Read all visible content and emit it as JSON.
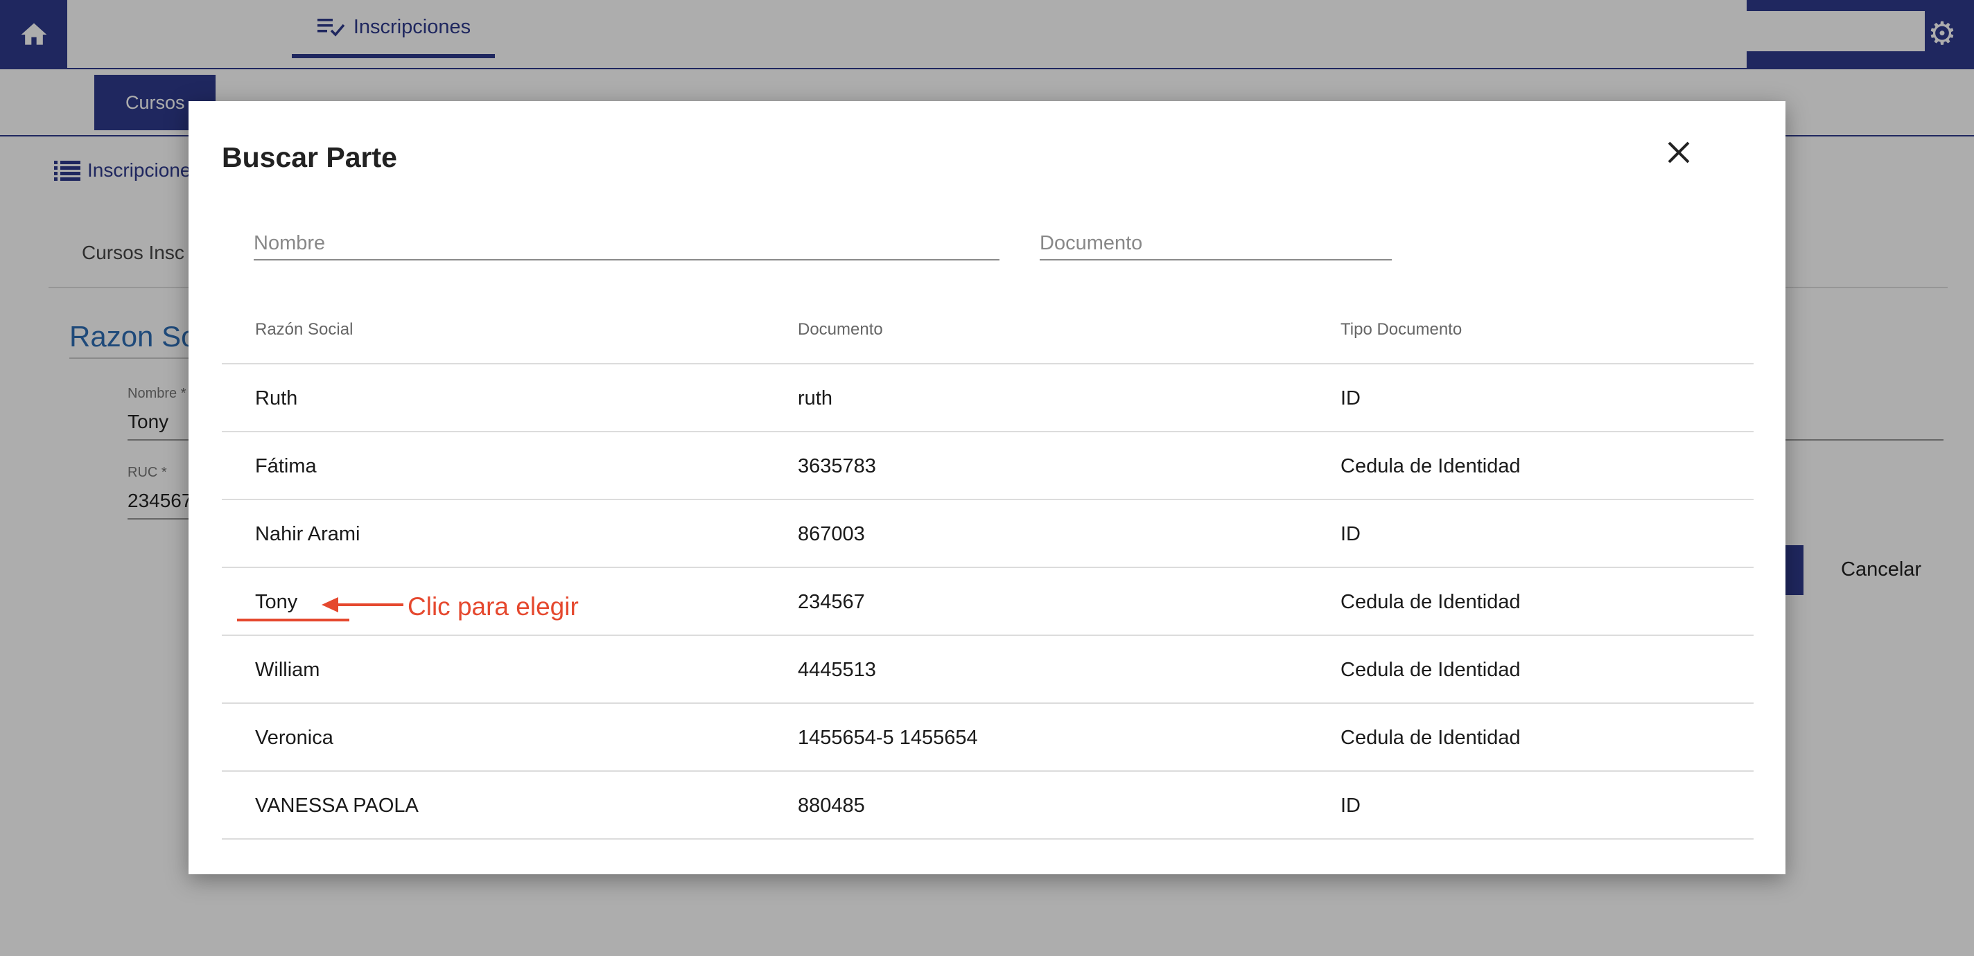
{
  "topbar": {
    "home_icon": "home-icon",
    "active_tab_label": "Inscripciones",
    "active_tab_icon": "playlist-check-icon",
    "settings_icon": "gear-icon",
    "accent_color": "#2e3a8c"
  },
  "subbar": {
    "tab_label": "Cursos"
  },
  "background": {
    "breadcrumb_label": "Inscripcione",
    "tab_label": "Cursos Insc",
    "section_title": "Razon So",
    "nombre_label": "Nombre *",
    "nombre_value": "Tony",
    "ruc_label": "RUC *",
    "ruc_value": "234567",
    "cancel_label": "Cancelar"
  },
  "modal": {
    "title": "Buscar Parte",
    "close_icon": "close-icon",
    "search": {
      "nombre_placeholder": "Nombre",
      "documento_placeholder": "Documento"
    },
    "table": {
      "headers": [
        "Razón Social",
        "Documento",
        "Tipo Documento"
      ],
      "rows": [
        {
          "razon_social": "Ruth",
          "documento": "ruth",
          "tipo": "ID"
        },
        {
          "razon_social": "Fátima",
          "documento": "3635783",
          "tipo": "Cedula de Identidad"
        },
        {
          "razon_social": "Nahir Arami",
          "documento": "867003",
          "tipo": "ID"
        },
        {
          "razon_social": "Tony",
          "documento": "234567",
          "tipo": "Cedula de Identidad"
        },
        {
          "razon_social": "William",
          "documento": "4445513",
          "tipo": "Cedula de Identidad"
        },
        {
          "razon_social": "Veronica",
          "documento": "1455654-5 1455654",
          "tipo": "Cedula de Identidad"
        },
        {
          "razon_social": "VANESSA PAOLA",
          "documento": "880485",
          "tipo": "ID"
        }
      ]
    }
  },
  "annotation": {
    "text": "Clic para elegir",
    "color": "#e5482e",
    "arrow_icon": "arrow-left-icon"
  }
}
